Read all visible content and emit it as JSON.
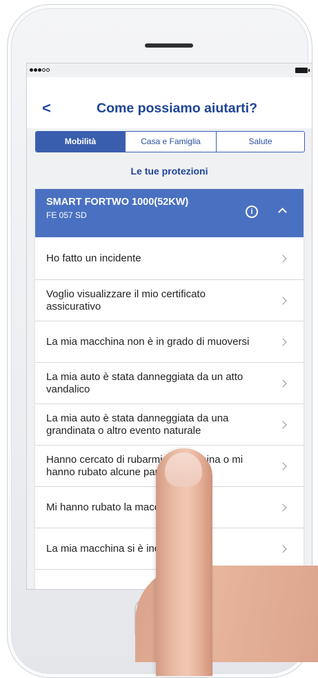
{
  "status_bar": {
    "signal_dots": 5,
    "signal_filled": 3
  },
  "header": {
    "back_glyph": "<",
    "title": "Come possiamo aiutarti?"
  },
  "tabs": [
    {
      "label": "Mobilità",
      "active": true
    },
    {
      "label": "Casa e Famiglia",
      "active": false
    },
    {
      "label": "Salute",
      "active": false
    }
  ],
  "section_title": "Le tue protezioni",
  "policy": {
    "vehicle": "SMART FORTWO 1000(52KW)",
    "plate": "FE 057 SD",
    "info_icon": "info-icon",
    "collapse_icon": "chevron-up-icon"
  },
  "options": [
    "Ho fatto un incidente",
    "Voglio visualizzare il mio certificato assicurativo",
    "La mia macchina non è in grado di muoversi",
    "La mia auto è stata danneggiata da un atto vandalico",
    "La mia auto è stata danneggiata da una grandinata o altro evento naturale",
    "Hanno cercato di rubarmi la macchina o mi hanno rubato alcune parti",
    "Mi hanno rubato la macchina",
    "La mia macchina si è incendiata"
  ],
  "colors": {
    "brand_blue": "#1f4598",
    "header_blue": "#4a71c1",
    "tab_active": "#3a5eae"
  }
}
